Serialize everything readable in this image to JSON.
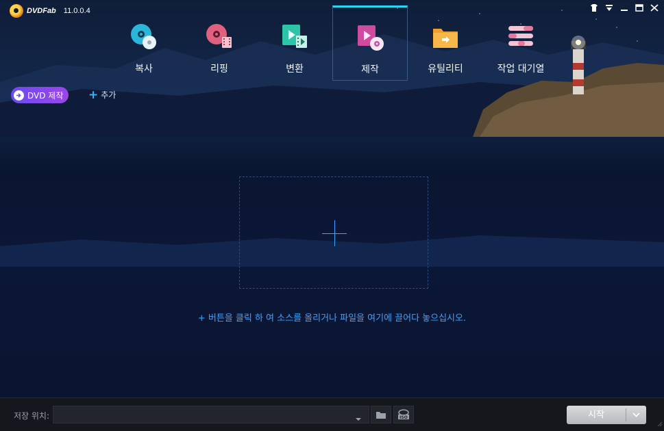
{
  "app": {
    "logo_text": "DVDFab",
    "version": "11.0.0.4"
  },
  "window_controls": [
    "skin-icon",
    "menu-icon",
    "minimize-icon",
    "maximize-icon",
    "close-icon"
  ],
  "nav": {
    "active": "제작",
    "items": [
      {
        "label": "복사",
        "icon": "copy-disc-icon"
      },
      {
        "label": "리핑",
        "icon": "ripper-icon"
      },
      {
        "label": "변환",
        "icon": "converter-icon"
      },
      {
        "label": "제작",
        "icon": "creator-icon"
      },
      {
        "label": "유틸리티",
        "icon": "utility-icon"
      },
      {
        "label": "작업 대기열",
        "icon": "task-queue-icon"
      }
    ]
  },
  "toolbar": {
    "mode_label": "DVD 제작",
    "add_label": "추가"
  },
  "main": {
    "hint": "+ 버튼을 클릭 하 여 소스를 올리거나 파일을 여기에 끌어다 놓으십시오."
  },
  "bottom": {
    "save_label": "저장 위치:",
    "save_value": "",
    "start_label": "시작"
  },
  "colors": {
    "accent": "#2fd3f5",
    "hint": "#3aa4ff",
    "mode_button": "#7b49ee"
  }
}
